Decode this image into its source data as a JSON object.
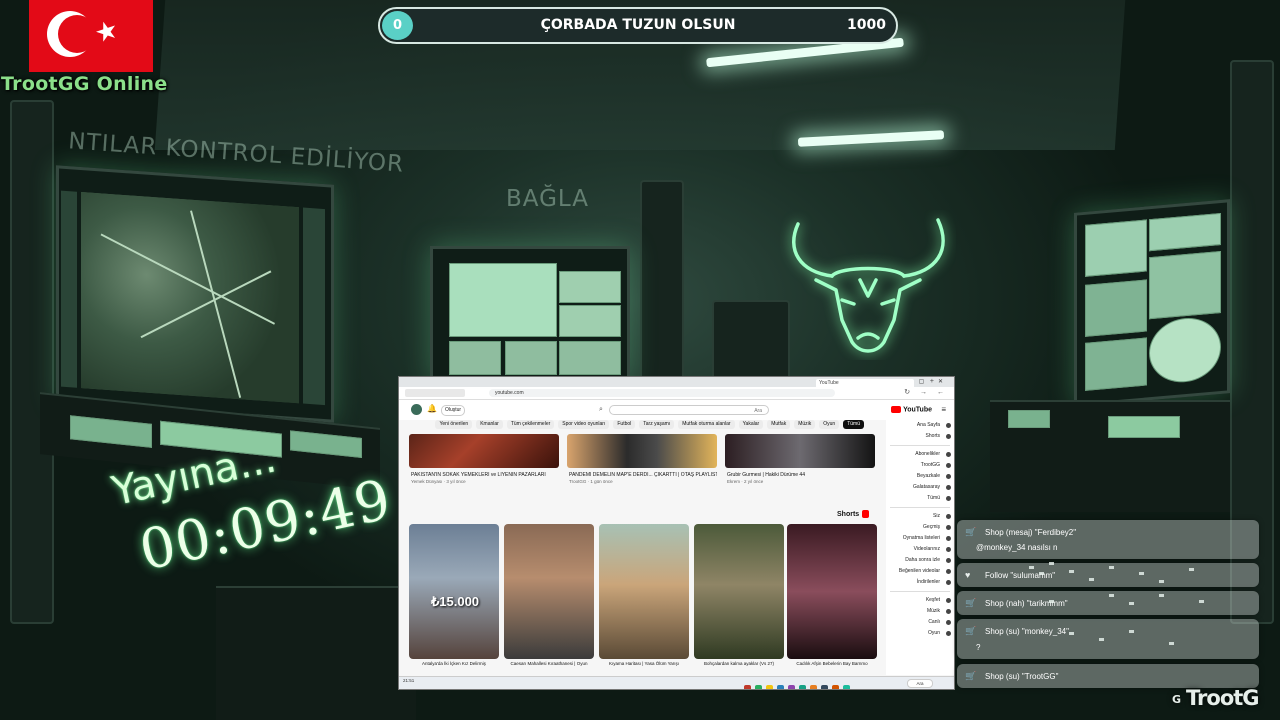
{
  "overlay": {
    "brand": "TrootGG Online",
    "wall_text_left": "NTILAR KONTROL EDİLİYOR",
    "wall_text_right": "BAĞLA",
    "goal_bar": {
      "current": "0",
      "title": "ÇORBADA TUZUN OLSUN",
      "max": "1000",
      "progress": 0
    },
    "countdown_label": "Yayına...",
    "countdown_time": "00:09:49",
    "footer_logo": "TrootG",
    "footer_logo_mark": "G"
  },
  "browser": {
    "tab_title": "YouTube",
    "address": "youtube.com",
    "youtube_logo": "YouTube",
    "search_placeholder": "Ara",
    "create_label": "Oluştur",
    "chips": [
      "Tümü",
      "Oyun",
      "Müzik",
      "Mutfak",
      "Yakalar",
      "Mutfak oturma alanlar",
      "Tarz yaşamı",
      "Futbol",
      "Spor video oyunları",
      "Tüm çekilenmeler",
      "Kmanlar",
      "Yeni önerilen"
    ],
    "sidebar": [
      {
        "label": "Ana Sayfa"
      },
      {
        "label": "Shorts"
      },
      {
        "label": "Abonelikler"
      },
      {
        "label": "TrootGG"
      },
      {
        "label": "Beyazkale"
      },
      {
        "label": "Galatasaray"
      },
      {
        "label": "Tümü"
      },
      {
        "label": "Siz"
      },
      {
        "label": "Geçmiş"
      },
      {
        "label": "Oynatma listeleri"
      },
      {
        "label": "Videolarınız"
      },
      {
        "label": "Daha sonra izle"
      },
      {
        "label": "Beğenilen videolar"
      },
      {
        "label": "İndirilenler"
      },
      {
        "label": "Keşfet"
      },
      {
        "label": "Müzik"
      },
      {
        "label": "Canlı"
      },
      {
        "label": "Oyun"
      }
    ],
    "videos": [
      {
        "title": "Grubir Gurmesi | Hakiki Dürüme 44",
        "sub": "Ekrem · 2 yıl önce"
      },
      {
        "title": "PANDEMİ DEMELİN MAP'E DERDİ... ÇIKARTTI | OTAŞ PLAYLIST |",
        "sub": "TrootGG · 1 gün önce"
      },
      {
        "title": "PAKİSTAN'IN SOKAK YEMEKLERİ ve LİYENİN PAZARLARI",
        "sub": "Yemek Dünyası · 3 yıl önce"
      }
    ],
    "shorts_heading": "Shorts",
    "shorts": [
      {
        "title": "Cadılık Afşin Bebelerin Bay Barnmo",
        "overlay": ""
      },
      {
        "title": "Bohçalardan kalma ayaklar (Vs 27)",
        "overlay": ""
      },
      {
        "title": "Kıyama Haritası | Yasa Ölüm Yarışı",
        "overlay": ""
      },
      {
        "title": "Caesarı Mahallesi Kıraathanesi | Oyun",
        "overlay": ""
      },
      {
        "title": "Antalya'da İki İçken Kız Delirmiş",
        "overlay": "₺15.000"
      }
    ],
    "taskbar_search": "Ara",
    "clock": "21:51"
  },
  "chat": [
    {
      "type": "Shop",
      "text": "Shop (mesaj) \"Ferdibey2\"",
      "sub": "@monkey_34 nasılsı n",
      "icon": "cart-icon"
    },
    {
      "type": "Follow",
      "text": "Follow \"sulumamm\"",
      "sub": "",
      "icon": "heart-icon"
    },
    {
      "type": "Shop",
      "text": "Shop (nah) \"tarikmmm\"",
      "sub": "",
      "icon": "cart-icon"
    },
    {
      "type": "Shop",
      "text": "Shop (su) \"monkey_34\"",
      "sub": "?",
      "icon": "cart-icon"
    },
    {
      "type": "Shop",
      "text": "Shop (su) \"TrootGG\"",
      "sub": "",
      "icon": "cart-icon"
    }
  ],
  "colors": {
    "accent": "#5ad0c6",
    "glow": "#7cf0a0",
    "youtube_red": "#ff0000"
  }
}
